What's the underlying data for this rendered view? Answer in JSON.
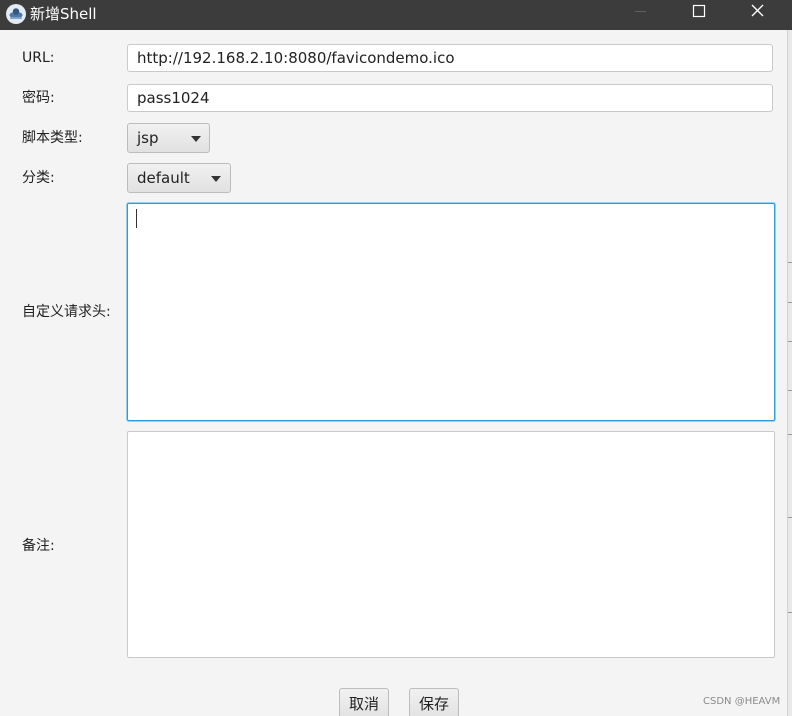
{
  "window": {
    "title": "新增Shell",
    "app_icon": "shell-manager-app-icon",
    "controls": {
      "minimize_icon": "minimize-icon",
      "maximize_icon": "maximize-icon",
      "close_icon": "close-icon"
    }
  },
  "form": {
    "url": {
      "label": "URL:",
      "value": "http://192.168.2.10:8080/favicondemo.ico"
    },
    "password": {
      "label": "密码:",
      "value": "pass1024"
    },
    "script_type": {
      "label": "脚本类型:",
      "selected": "jsp",
      "icon": "chevron-down-icon"
    },
    "category": {
      "label": "分类:",
      "selected": "default",
      "icon": "chevron-down-icon"
    },
    "custom_headers": {
      "label": "自定义请求头:",
      "value": ""
    },
    "notes": {
      "label": "备注:",
      "value": ""
    }
  },
  "buttons": {
    "cancel": "取消",
    "save": "保存"
  },
  "watermark": "CSDN @HEAVM",
  "colors": {
    "titlebar": "#3c3c3c",
    "focus_border": "#2f9bd9",
    "background": "#f4f4f4"
  }
}
